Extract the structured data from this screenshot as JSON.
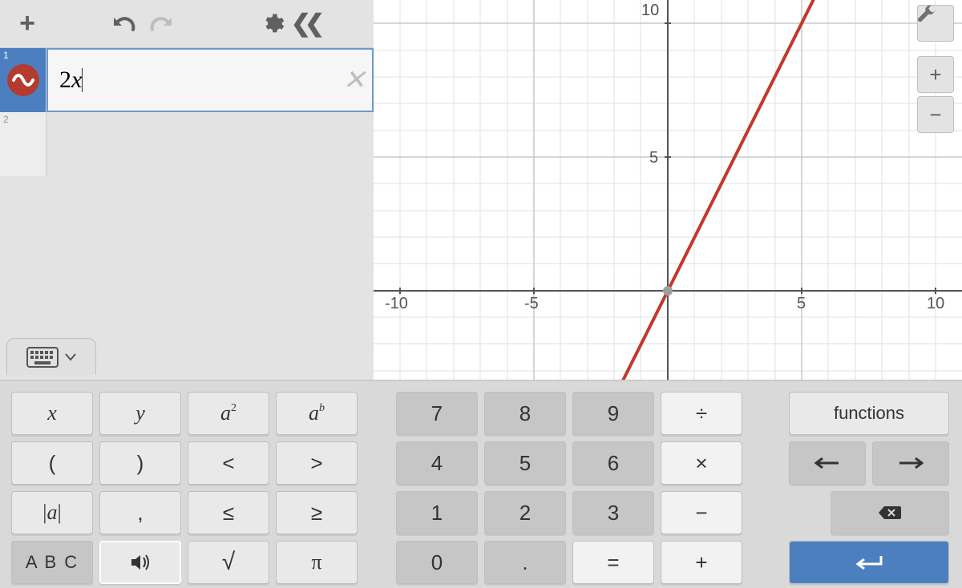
{
  "chart_data": {
    "type": "line",
    "series": [
      {
        "name": "2x",
        "slope": 2,
        "intercept": 0,
        "color": "#c0392b"
      }
    ],
    "xlim": [
      -11,
      11
    ],
    "ylim": [
      -3.5,
      11.5
    ],
    "xticks": [
      -10,
      -5,
      0,
      5,
      10
    ],
    "yticks": [
      5,
      10
    ],
    "gridlines": true
  },
  "toolbar": {
    "add": "+",
    "undo": "↶",
    "redo": "↷"
  },
  "expressions": [
    {
      "index": "1",
      "value": "2x"
    },
    {
      "index": "2",
      "value": ""
    }
  ],
  "axis_labels": {
    "xneg10": "-10",
    "xneg5": "-5",
    "x5": "5",
    "x10": "10",
    "y5": "5",
    "y10": "10"
  },
  "keypad": {
    "left": {
      "r0": [
        "x",
        "y",
        "a²",
        "aᵇ"
      ],
      "r1": [
        "(",
        ")",
        "<",
        ">"
      ],
      "r2": [
        "|a|",
        ",",
        "≤",
        "≥"
      ],
      "r3": [
        "A B C",
        "",
        "√",
        "π"
      ]
    },
    "num": {
      "r0": [
        "7",
        "8",
        "9",
        "÷"
      ],
      "r1": [
        "4",
        "5",
        "6",
        "×"
      ],
      "r2": [
        "1",
        "2",
        "3",
        "−"
      ],
      "r3": [
        "0",
        ".",
        "=",
        "+"
      ]
    },
    "right": {
      "functions": "functions",
      "left": "⟵",
      "right": "⟶",
      "backspace": "⌫",
      "enter": "⏎"
    }
  }
}
